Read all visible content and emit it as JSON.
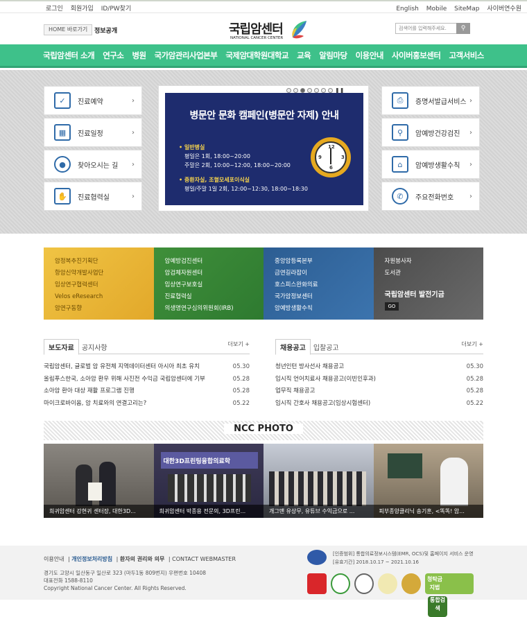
{
  "topbar": {
    "login": "로그인",
    "join": "회원가입",
    "find": "ID/PW찾기",
    "english": "English",
    "mobile": "Mobile",
    "sitemap": "SiteMap",
    "cyber": "사이버연수원"
  },
  "header": {
    "home_btn": "HOME 바로가기",
    "open_info": "정보공개",
    "logo_name": "국립암센터",
    "logo_sub": "NATIONAL CANCER CENTER",
    "search_placeholder": "검색어를 입력해주세요."
  },
  "nav": [
    "국립암센터 소개",
    "연구소",
    "병원",
    "국가암관리사업본부",
    "국제암대학원대학교",
    "교육",
    "알림마당",
    "이용안내",
    "사이버홍보센터",
    "고객서비스"
  ],
  "quick_left": [
    {
      "label": "진료예약",
      "icon": "clipboard-check-icon"
    },
    {
      "label": "진료일정",
      "icon": "calendar-icon"
    },
    {
      "label": "찾아오시는 길",
      "icon": "map-pin-icon"
    },
    {
      "label": "진료협력실",
      "icon": "handshake-icon"
    }
  ],
  "quick_right": [
    {
      "label": "증명서발급서비스",
      "icon": "printer-icon"
    },
    {
      "label": "암예방건강검진",
      "icon": "search-person-icon"
    },
    {
      "label": "암예방생활수칙",
      "icon": "house-heart-icon"
    },
    {
      "label": "주요전화번호",
      "icon": "phone-icon"
    }
  ],
  "slide": {
    "title": "병문안 문화 캠페인(병문안 자제) 안내",
    "section1": "• 일반병실",
    "line1": "평일은 1회, 18:00~20:00",
    "line2": "주말은 2회, 10:00~12:00, 18:00~20:00",
    "section2": "• 중환자실, 조혈모세포이식실",
    "line3": "평일/주말 1일 2회, 12:00~12:30, 18:00~18:30"
  },
  "banners": [
    {
      "items": [
        "암정복추진기획단",
        "항암신약개발사업단",
        "임상연구협력센터",
        "Velos eResearch",
        "암연구동향"
      ],
      "color": "#e4b830"
    },
    {
      "items": [
        "암예방검진센터",
        "암검체자원센터",
        "임상연구보호실",
        "진료협력실",
        "의생명연구심의위원회(IRB)"
      ],
      "color": "#3f8f3a"
    },
    {
      "items": [
        "중앙암등록본부",
        "금연길라잡이",
        "호스피스완화의료",
        "국가암정보센터",
        "암예방생활수칙"
      ],
      "color": "#2c5d92"
    },
    {
      "items": [
        "자원봉사자",
        "도서관"
      ],
      "fund": "국립암센터 발전기금",
      "go": "GO",
      "color": "#555"
    }
  ],
  "board_left": {
    "tab1": "보도자료",
    "tab2": "공지사항",
    "more": "더보기 +",
    "items": [
      {
        "t": "국립암센터, 글로벌 암 유전체 지역데이터센터 아시아 최초 유치",
        "d": "05.30"
      },
      {
        "t": "올림푸스한국, 소아암 환우 위해 사진전 수익금 국립암센터에 기부",
        "d": "05.28"
      },
      {
        "t": "소아암 환아 대상 재활 프로그램 진행",
        "d": "05.28"
      },
      {
        "t": "마이크로바이옴, 암 치료와의 연결고리는?",
        "d": "05.22"
      }
    ]
  },
  "board_right": {
    "tab1": "채용공고",
    "tab2": "입찰공고",
    "more": "더보기 +",
    "items": [
      {
        "t": "청년인턴 방사선사 채용공고",
        "d": "05.30"
      },
      {
        "t": "임시직 언어치료사 채용공고(이빈인후과)",
        "d": "05.28"
      },
      {
        "t": "업무직 채용공고",
        "d": "05.28"
      },
      {
        "t": "임시직 간호사 채용공고(임상시험센터)",
        "d": "05.22"
      }
    ]
  },
  "photo": {
    "title": "NCC PHOTO",
    "items": [
      {
        "cap": "희귀암센터 강현귀 센터장, 대한3D...",
        "bg": "#6d6a66"
      },
      {
        "cap": "희귀암센터 박종용 전문의, 3D프린...",
        "bg": "#4a4560",
        "banner": "대한3D프린팅융합의료학"
      },
      {
        "cap": "개그맨 유상무, 유튜브 수익금으로 ...",
        "bg": "#8a8f9a"
      },
      {
        "cap": "피부종양클리닉 송기훈, <똑똑! 암...",
        "bg": "#9a8c7a"
      }
    ]
  },
  "footer": {
    "links": [
      "이용안내",
      "개인정보처리방침",
      "환자의 권리와 의무",
      "CONTACT WEBMASTER"
    ],
    "addr1": "경기도 고양시 일산동구 일산로 323 (마두1동 809번지) 우편번호 10408",
    "addr2": "대표전화 1588-8110",
    "copy": "Copyright National Cancer Center. All Rights Reserved.",
    "cert1": "[인증범위] 통합의료정보시스템(EMR, OCS)및 홈페이지 서비스 운영",
    "cert2": "[유효기간] 2018.10.17 ~ 2021.10.16",
    "award_last1": "청탁금지법",
    "award_last2": "통합검색"
  }
}
